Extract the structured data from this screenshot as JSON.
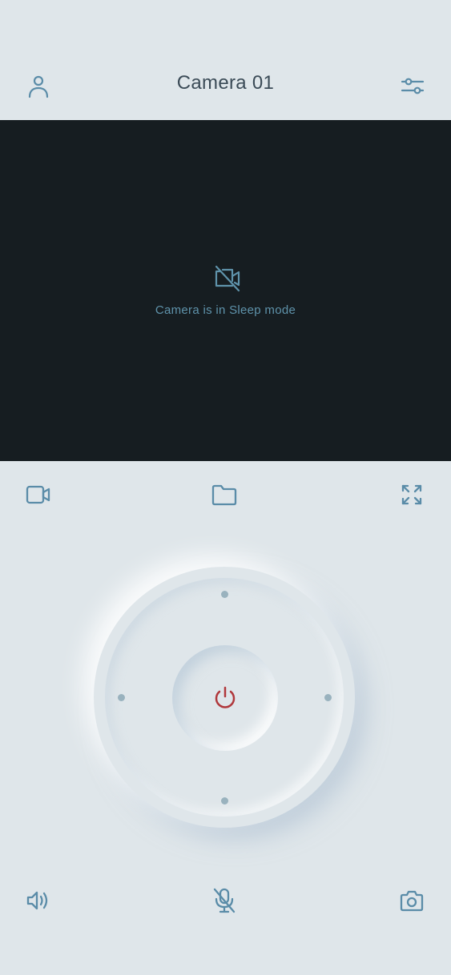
{
  "header": {
    "title": "Camera 01",
    "left_icon": "user-icon",
    "right_icon": "sliders-icon"
  },
  "video": {
    "status_icon": "video-off-icon",
    "status_text": "Camera is in Sleep mode"
  },
  "toolbar": {
    "left_icon": "video-camera-icon",
    "center_icon": "folder-icon",
    "right_icon": "fullscreen-icon"
  },
  "controls": {
    "center_icon": "power-icon",
    "directions": [
      "up",
      "left",
      "right",
      "down"
    ]
  },
  "bottom_bar": {
    "left_icon": "speaker-icon",
    "center_icon": "mic-off-icon",
    "right_icon": "camera-icon"
  },
  "colors": {
    "background": "#dfe6ea",
    "video_background": "#161d21",
    "icon": "#5a8ca8",
    "title_text": "#3b4b57",
    "power_red": "#b0383c",
    "dot": "#99b2be"
  }
}
